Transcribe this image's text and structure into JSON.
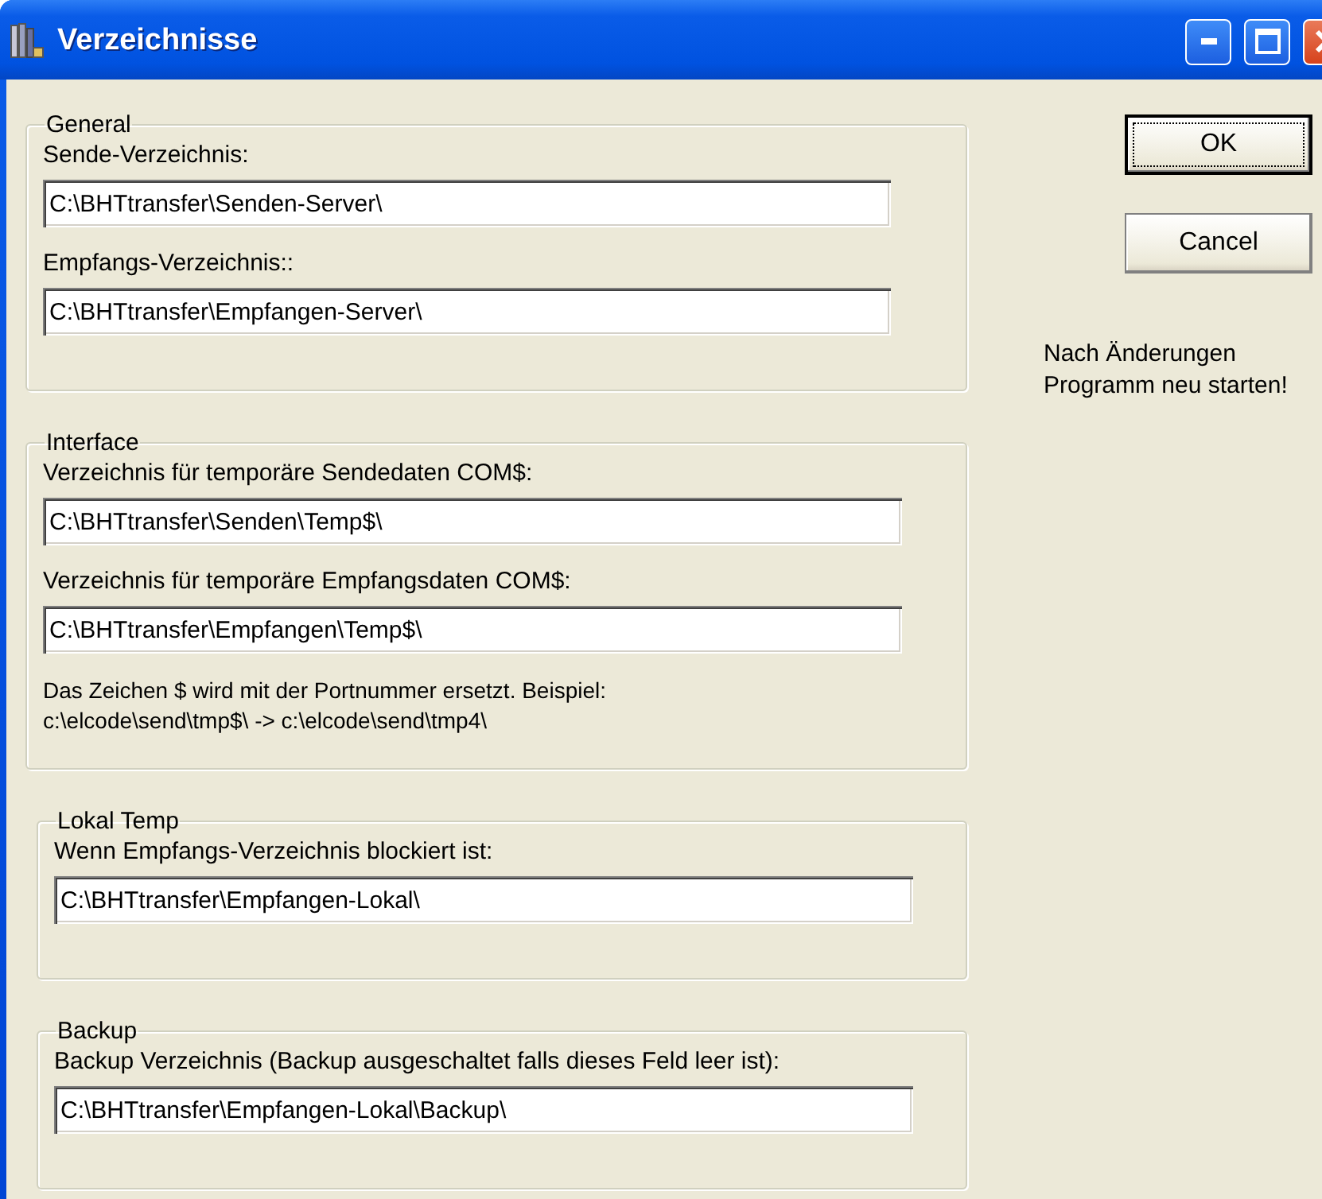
{
  "window": {
    "title": "Verzeichnisse"
  },
  "groups": [
    {
      "title": "General",
      "fields": [
        {
          "label": "Sende-Verzeichnis:",
          "value": "C:\\BHTtransfer\\Senden-Server\\"
        },
        {
          "label": "Empfangs-Verzeichnis::",
          "value": "C:\\BHTtransfer\\Empfangen-Server\\"
        }
      ]
    },
    {
      "title": "Interface",
      "fields": [
        {
          "label": "Verzeichnis für temporäre Sendedaten COM$:",
          "value": "C:\\BHTtransfer\\Senden\\Temp$\\"
        },
        {
          "label": "Verzeichnis für temporäre Empfangsdaten COM$:",
          "value": "C:\\BHTtransfer\\Empfangen\\Temp$\\"
        }
      ],
      "note": [
        "Das Zeichen $ wird mit der Portnummer ersetzt. Beispiel:",
        "c:\\elcode\\send\\tmp$\\ -> c:\\elcode\\send\\tmp4\\"
      ]
    },
    {
      "title": "Lokal Temp",
      "fields": [
        {
          "label": "Wenn Empfangs-Verzeichnis blockiert ist:",
          "value": "C:\\BHTtransfer\\Empfangen-Lokal\\"
        }
      ]
    },
    {
      "title": "Backup",
      "fields": [
        {
          "label": "Backup Verzeichnis (Backup ausgeschaltet falls dieses Feld leer ist):",
          "value": "C:\\BHTtransfer\\Empfangen-Lokal\\Backup\\"
        }
      ]
    }
  ],
  "buttons": [
    {
      "label": "OK",
      "default": true
    },
    {
      "label": "Cancel",
      "default": false
    }
  ],
  "hint": [
    "Nach Änderungen",
    "Programm neu starten!"
  ]
}
